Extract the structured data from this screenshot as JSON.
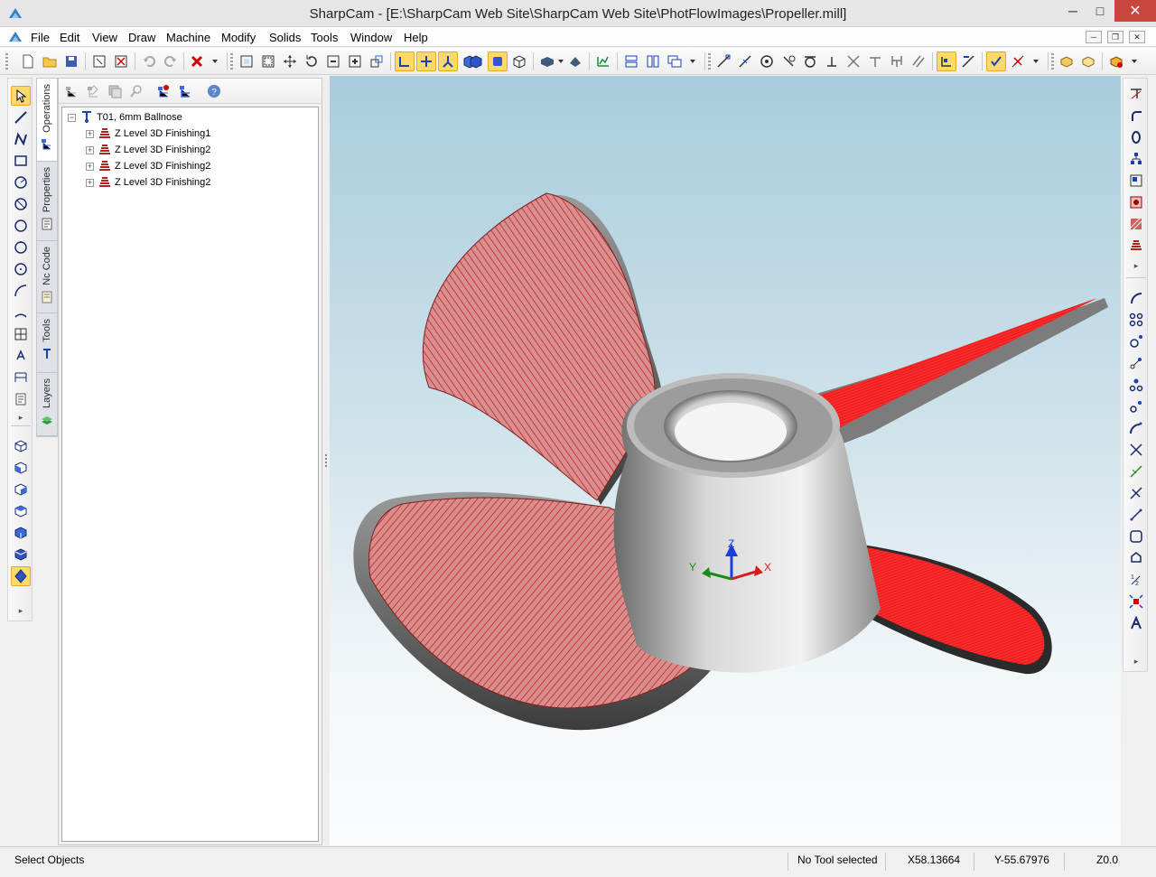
{
  "window": {
    "title": "SharpCam - [E:\\SharpCam Web Site\\SharpCam Web Site\\PhotFlowImages\\Propeller.mill]",
    "minimize": "─",
    "maximize": "□",
    "close": "✕"
  },
  "menu": {
    "items": [
      {
        "label": "File",
        "accel": "F"
      },
      {
        "label": "Edit",
        "accel": "E"
      },
      {
        "label": "View",
        "accel": "V"
      },
      {
        "label": "Draw",
        "accel": "D"
      },
      {
        "label": "Machine",
        "accel": "M"
      },
      {
        "label": "Modify",
        "accel": "M"
      },
      {
        "label": "Solids",
        "accel": "S"
      },
      {
        "label": "Tools",
        "accel": "T"
      },
      {
        "label": "Window",
        "accel": "W"
      },
      {
        "label": "Help",
        "accel": "H"
      }
    ],
    "mdi_minimize": "─",
    "mdi_restore": "❐",
    "mdi_close": "✕"
  },
  "side_tabs": [
    "Operations",
    "Properties",
    "Nc Code",
    "Tools",
    "Layers"
  ],
  "tree": {
    "tool": "T01, 6mm Ballnose",
    "operations": [
      "Z Level 3D Finishing1",
      "Z Level 3D Finishing2",
      "Z Level 3D Finishing2",
      "Z Level 3D Finishing2"
    ]
  },
  "axes": {
    "x": "X",
    "y": "Y",
    "z": "Z"
  },
  "status": {
    "message": "Select Objects",
    "tool": "No Tool selected",
    "x": "X58.13664",
    "y": "Y-55.67976",
    "z": "Z0.0"
  },
  "colors": {
    "toolpath": "#e01010",
    "active_button": "#fcd96b",
    "close_button": "#c7463d"
  }
}
